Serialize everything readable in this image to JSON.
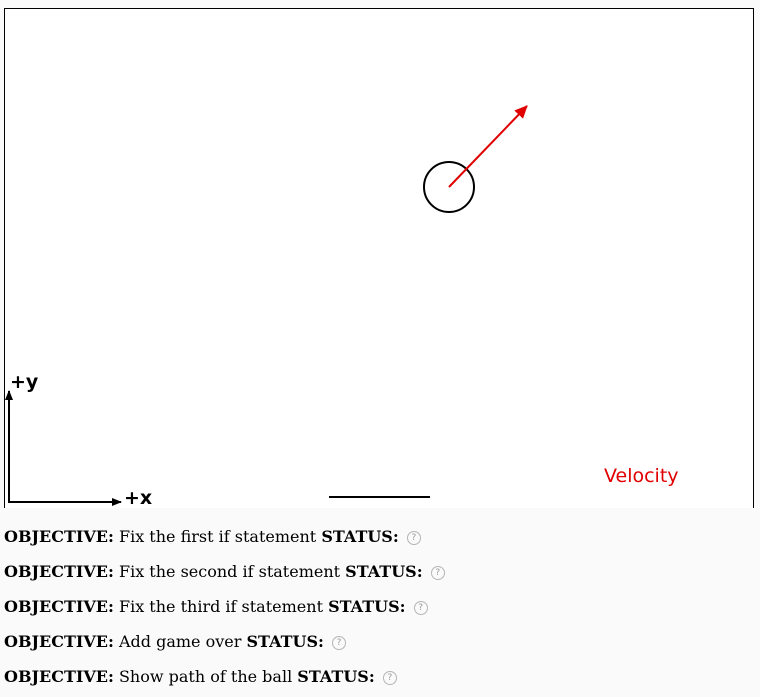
{
  "canvas": {
    "axis_x_label": "+x",
    "axis_y_label": "+y",
    "velocity_label": "Velocity",
    "velocity_color": "#e00000",
    "border_color": "#000000"
  },
  "objectives": [
    {
      "prefix": "OBJECTIVE:",
      "text": "Fix the first if statement",
      "status_label": "STATUS:",
      "status_icon": "question-circle-icon"
    },
    {
      "prefix": "OBJECTIVE:",
      "text": "Fix the second if statement",
      "status_label": "STATUS:",
      "status_icon": "question-circle-icon"
    },
    {
      "prefix": "OBJECTIVE:",
      "text": "Fix the third if statement",
      "status_label": "STATUS:",
      "status_icon": "question-circle-icon"
    },
    {
      "prefix": "OBJECTIVE:",
      "text": "Add game over",
      "status_label": "STATUS:",
      "status_icon": "question-circle-icon"
    },
    {
      "prefix": "OBJECTIVE:",
      "text": "Show path of the ball",
      "status_label": "STATUS:",
      "status_icon": "question-circle-icon"
    }
  ],
  "status_icon_glyph": "?"
}
